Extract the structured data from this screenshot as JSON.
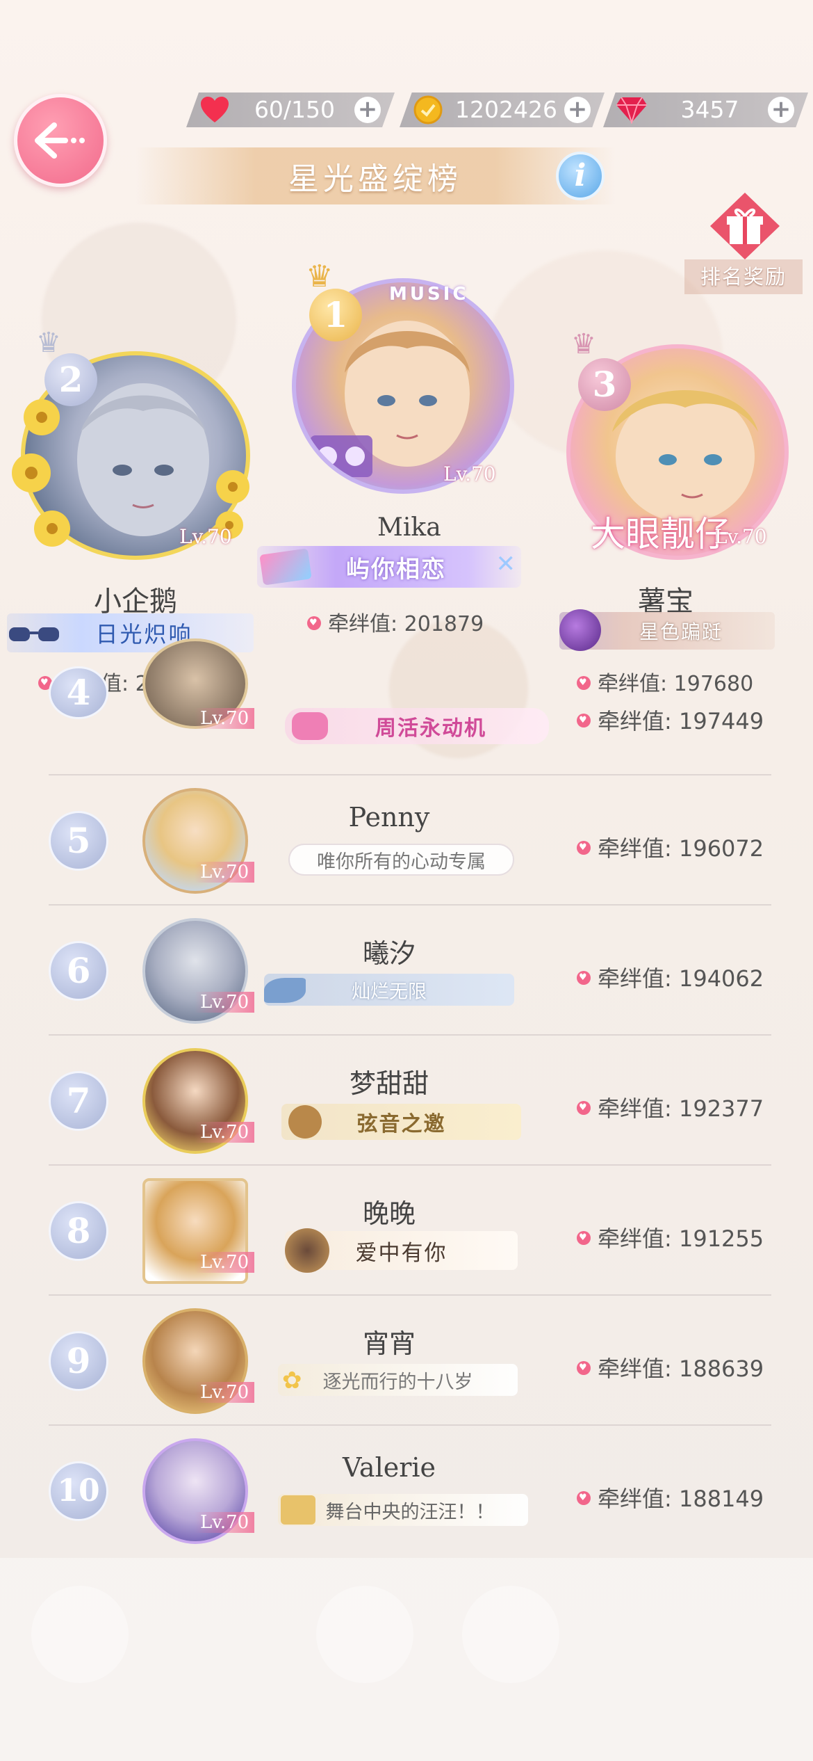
{
  "header": {
    "stamina": "60/150",
    "gold": "1202426",
    "diamonds": "3457",
    "title": "星光盛绽榜",
    "info_label": "i",
    "reward_label": "排名奖励"
  },
  "top3": [
    {
      "rank": "2",
      "name": "小企鹅",
      "level": "Lv.70",
      "badge": "日光炽响",
      "bond_label": "牵绊值:",
      "bond": "200221"
    },
    {
      "rank": "1",
      "name": "Mika",
      "level": "Lv.70",
      "badge": "屿你相恋",
      "badge_tag": "MUSIC",
      "bond_label": "牵绊值:",
      "bond": "201879"
    },
    {
      "rank": "3",
      "name": "薯宝",
      "level": "Lv.70",
      "badge": "星色蹁跹",
      "avatar_text": "大眼靓仔",
      "bond_label": "牵绊值:",
      "bond": "197680"
    }
  ],
  "rows": [
    {
      "rank": "4",
      "level": "Lv.70",
      "badge": "周活永动机",
      "bond_label": "牵绊值:",
      "bond": "197449"
    },
    {
      "rank": "5",
      "name": "Penny",
      "level": "Lv.70",
      "badge": "唯你所有的心动专属",
      "bond_label": "牵绊值:",
      "bond": "196072"
    },
    {
      "rank": "6",
      "name": "曦汐",
      "level": "Lv.70",
      "badge": "灿烂无限",
      "bond_label": "牵绊值:",
      "bond": "194062"
    },
    {
      "rank": "7",
      "name": "梦甜甜",
      "level": "Lv.70",
      "badge": "弦音之邀",
      "bond_label": "牵绊值:",
      "bond": "192377"
    },
    {
      "rank": "8",
      "name": "晚晚",
      "level": "Lv.70",
      "badge": "爱中有你",
      "bond_label": "牵绊值:",
      "bond": "191255"
    },
    {
      "rank": "9",
      "name": "宵宵",
      "level": "Lv.70",
      "badge": "逐光而行的十八岁",
      "bond_label": "牵绊值:",
      "bond": "188639"
    },
    {
      "rank": "10",
      "name": "Valerie",
      "level": "Lv.70",
      "badge": "舞台中央的汪汪！！",
      "bond_label": "牵绊值:",
      "bond": "188149"
    }
  ],
  "colors": {
    "accent_pink": "#f26b8c",
    "gold": "#e7c77d",
    "rank_badge": "#a9b4d6"
  }
}
